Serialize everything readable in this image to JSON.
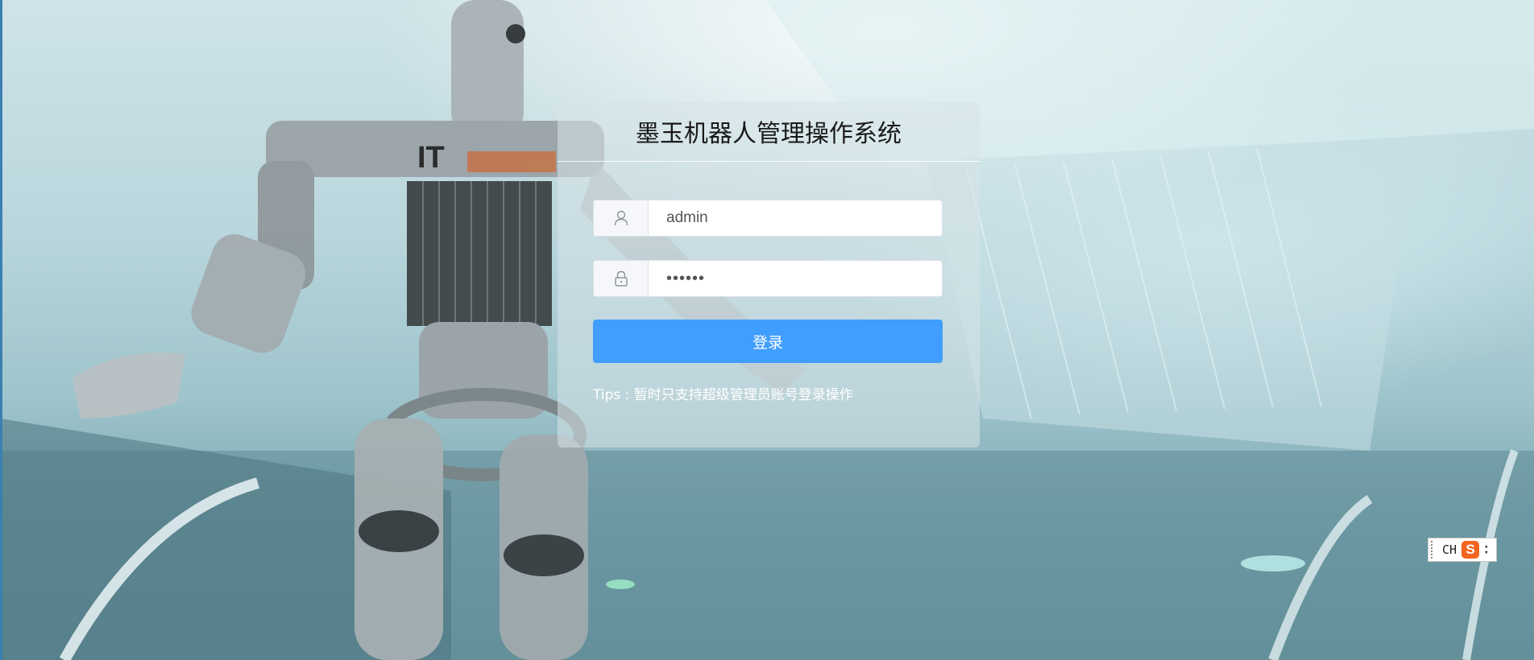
{
  "login": {
    "title": "墨玉机器人管理操作系统",
    "username_value": "admin",
    "password_value": "••••••",
    "submit_label": "登录",
    "tips": "Tips : 暂时只支持超级管理员账号登录操作"
  },
  "ime": {
    "lang": "CH",
    "logo_letter": "S"
  },
  "icons": {
    "username": "user-icon",
    "password": "lock-icon"
  },
  "colors": {
    "primary": "#409eff",
    "tips_text": "#ffffff"
  }
}
